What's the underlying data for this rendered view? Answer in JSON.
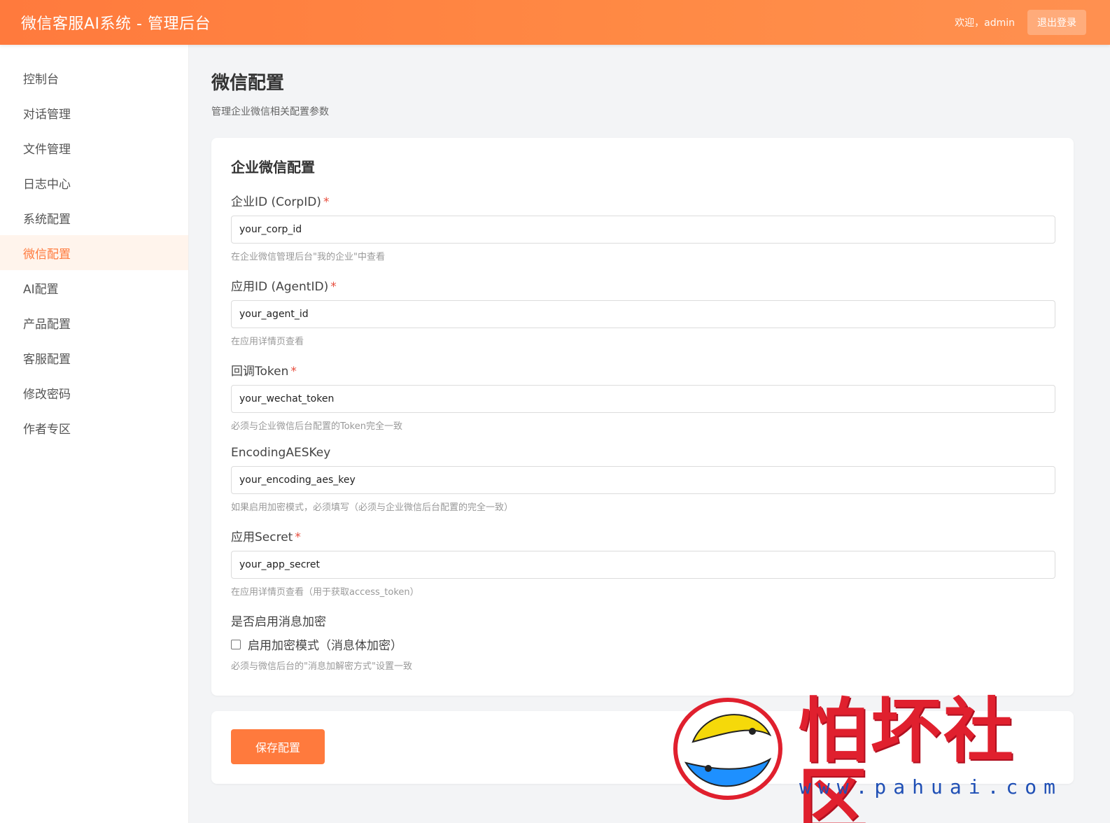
{
  "header": {
    "brand": "微信客服AI系统 - 管理后台",
    "welcome": "欢迎，admin",
    "logout_label": "退出登录"
  },
  "sidebar": {
    "items": [
      {
        "label": "控制台"
      },
      {
        "label": "对话管理"
      },
      {
        "label": "文件管理"
      },
      {
        "label": "日志中心"
      },
      {
        "label": "系统配置"
      },
      {
        "label": "微信配置",
        "active": true
      },
      {
        "label": "AI配置"
      },
      {
        "label": "产品配置"
      },
      {
        "label": "客服配置"
      },
      {
        "label": "修改密码"
      },
      {
        "label": "作者专区"
      }
    ]
  },
  "page": {
    "title": "微信配置",
    "subtitle": "管理企业微信相关配置参数"
  },
  "form": {
    "section_title": "企业微信配置",
    "fields": [
      {
        "label": "企业ID (CorpID)",
        "required": "*",
        "value": "your_corp_id",
        "hint": "在企业微信管理后台\"我的企业\"中查看"
      },
      {
        "label": "应用ID (AgentID)",
        "required": "*",
        "value": "your_agent_id",
        "hint": "在应用详情页查看"
      },
      {
        "label": "回调Token",
        "required": "*",
        "value": "your_wechat_token",
        "hint": "必须与企业微信后台配置的Token完全一致"
      },
      {
        "label": "EncodingAESKey",
        "value": "your_encoding_aes_key",
        "hint": "如果启用加密模式，必须填写（必须与企业微信后台配置的完全一致）"
      },
      {
        "label": "应用Secret",
        "required": "*",
        "value": "your_app_secret",
        "hint": "在应用详情页查看（用于获取access_token）"
      }
    ],
    "encryption": {
      "label": "是否启用消息加密",
      "checkbox_label": "启用加密模式（消息体加密）",
      "checked": false,
      "hint": "必须与微信后台的\"消息加解密方式\"设置一致"
    },
    "save_label": "保存配置"
  },
  "watermark": {
    "text": "怕坏社区",
    "url": "www.pahuai.com"
  },
  "colors": {
    "accent": "#ff7a3d",
    "required": "#e74c3c"
  }
}
